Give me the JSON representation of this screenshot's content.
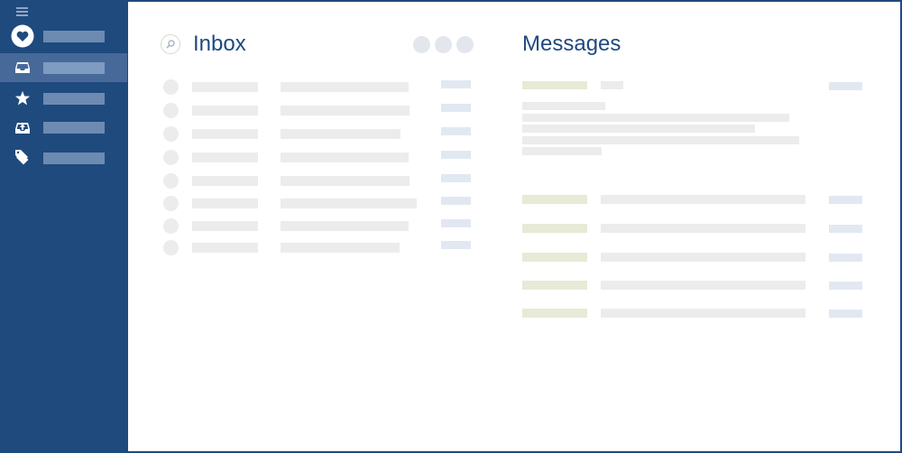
{
  "app": {
    "accent_color": "#1f4a7e",
    "placeholder_gray": "#ececec",
    "placeholder_blue": "#e2e8f2",
    "placeholder_green": "#e7ead6"
  },
  "sidebar": {
    "menu_icon": "hamburger-icon",
    "items": [
      {
        "id": "favorites",
        "icon": "heart-icon",
        "active": false
      },
      {
        "id": "inbox",
        "icon": "inbox-tray-icon",
        "active": true
      },
      {
        "id": "starred",
        "icon": "star-icon",
        "active": false
      },
      {
        "id": "outbox",
        "icon": "outbox-tray-icon",
        "active": false
      },
      {
        "id": "tags",
        "icon": "tag-icon",
        "active": false
      }
    ]
  },
  "inbox": {
    "title": "Inbox",
    "search_icon": "search-icon",
    "action_dots": 3,
    "rows": 8
  },
  "messages": {
    "title": "Messages",
    "header_rows": 1,
    "body_lines": 5,
    "rows": 5
  }
}
